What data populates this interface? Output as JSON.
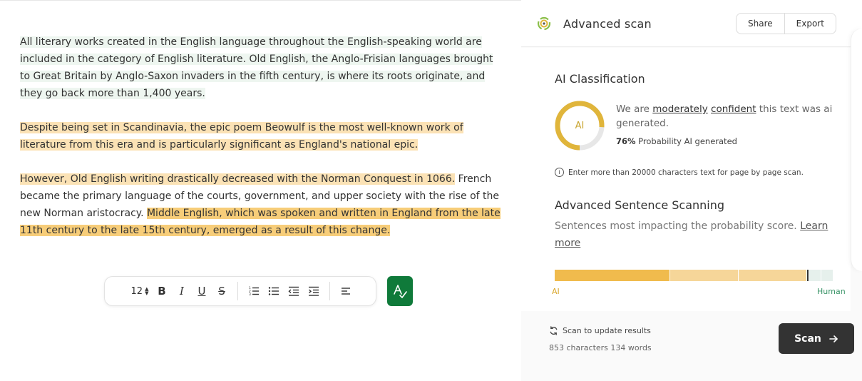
{
  "editor": {
    "paragraphs": [
      [
        {
          "text": "All literary works created in the English language throughout the English-speaking world are included in the category of English literature. Old English, the Anglo-Frisian languages brought to Great Britain by Anglo-Saxon invaders in the fifth century, is where its roots originate, and they go back more than 1,400 years.",
          "highlight": "light"
        }
      ],
      [
        {
          "text": "Despite being set in Scandinavia, the epic poem Beowulf is the most well-known work of literature from this era and is particularly significant as England's national epic.",
          "highlight": "peach"
        }
      ],
      [
        {
          "text": "However, Old English writing drastically decreased with the Norman Conquest in 1066.",
          "highlight": "peach"
        },
        {
          "text": " French became the primary language of the courts, government, and upper society with the rise of the new Norman aristocracy. ",
          "highlight": "none"
        },
        {
          "text": "Middle English, which was spoken and written in England from the late 11th century to the late 15th century, emerged as a result of this change.",
          "highlight": "gold"
        }
      ]
    ],
    "toolbar": {
      "font_size": "12",
      "bold": "B",
      "italic": "I",
      "underline": "U",
      "strike": "S"
    }
  },
  "panel": {
    "title": "Advanced scan",
    "share_label": "Share",
    "export_label": "Export",
    "classification": {
      "heading": "AI Classification",
      "ring_label": "AI",
      "ring_fraction": 0.76,
      "conf_prefix": "We are ",
      "conf_word1": "moderately",
      "conf_word2": "confident",
      "conf_suffix": " this text was ai generated.",
      "prob_value": "76%",
      "prob_text": " Probability AI generated",
      "note": "Enter more than 20000 characters text for page by page scan."
    },
    "sentence_scan": {
      "heading": "Advanced Sentence Scanning",
      "desc": "Sentences most impacting the probability score. ",
      "learn_more": "Learn more",
      "ai_label": "AI",
      "human_label": "Human",
      "segments": [
        {
          "fraction": 0.405,
          "color": "#f0bb4d"
        },
        {
          "fraction": 0.24,
          "color": "#f6d699"
        },
        {
          "fraction": 0.24,
          "color": "#f6d699"
        },
        {
          "fraction": 0.005,
          "color": "marker"
        },
        {
          "fraction": 0.04,
          "color": "#e6f0ec"
        },
        {
          "fraction": 0.04,
          "color": "#e6f0ec"
        }
      ]
    },
    "footer": {
      "update_text": "Scan to update results",
      "counts": "853 characters 134 words",
      "scan_label": "Scan"
    },
    "colors": {
      "ring": "#e0b53b",
      "ring_track": "#e7e7e7",
      "accent_green": "#0f7a3a"
    }
  }
}
